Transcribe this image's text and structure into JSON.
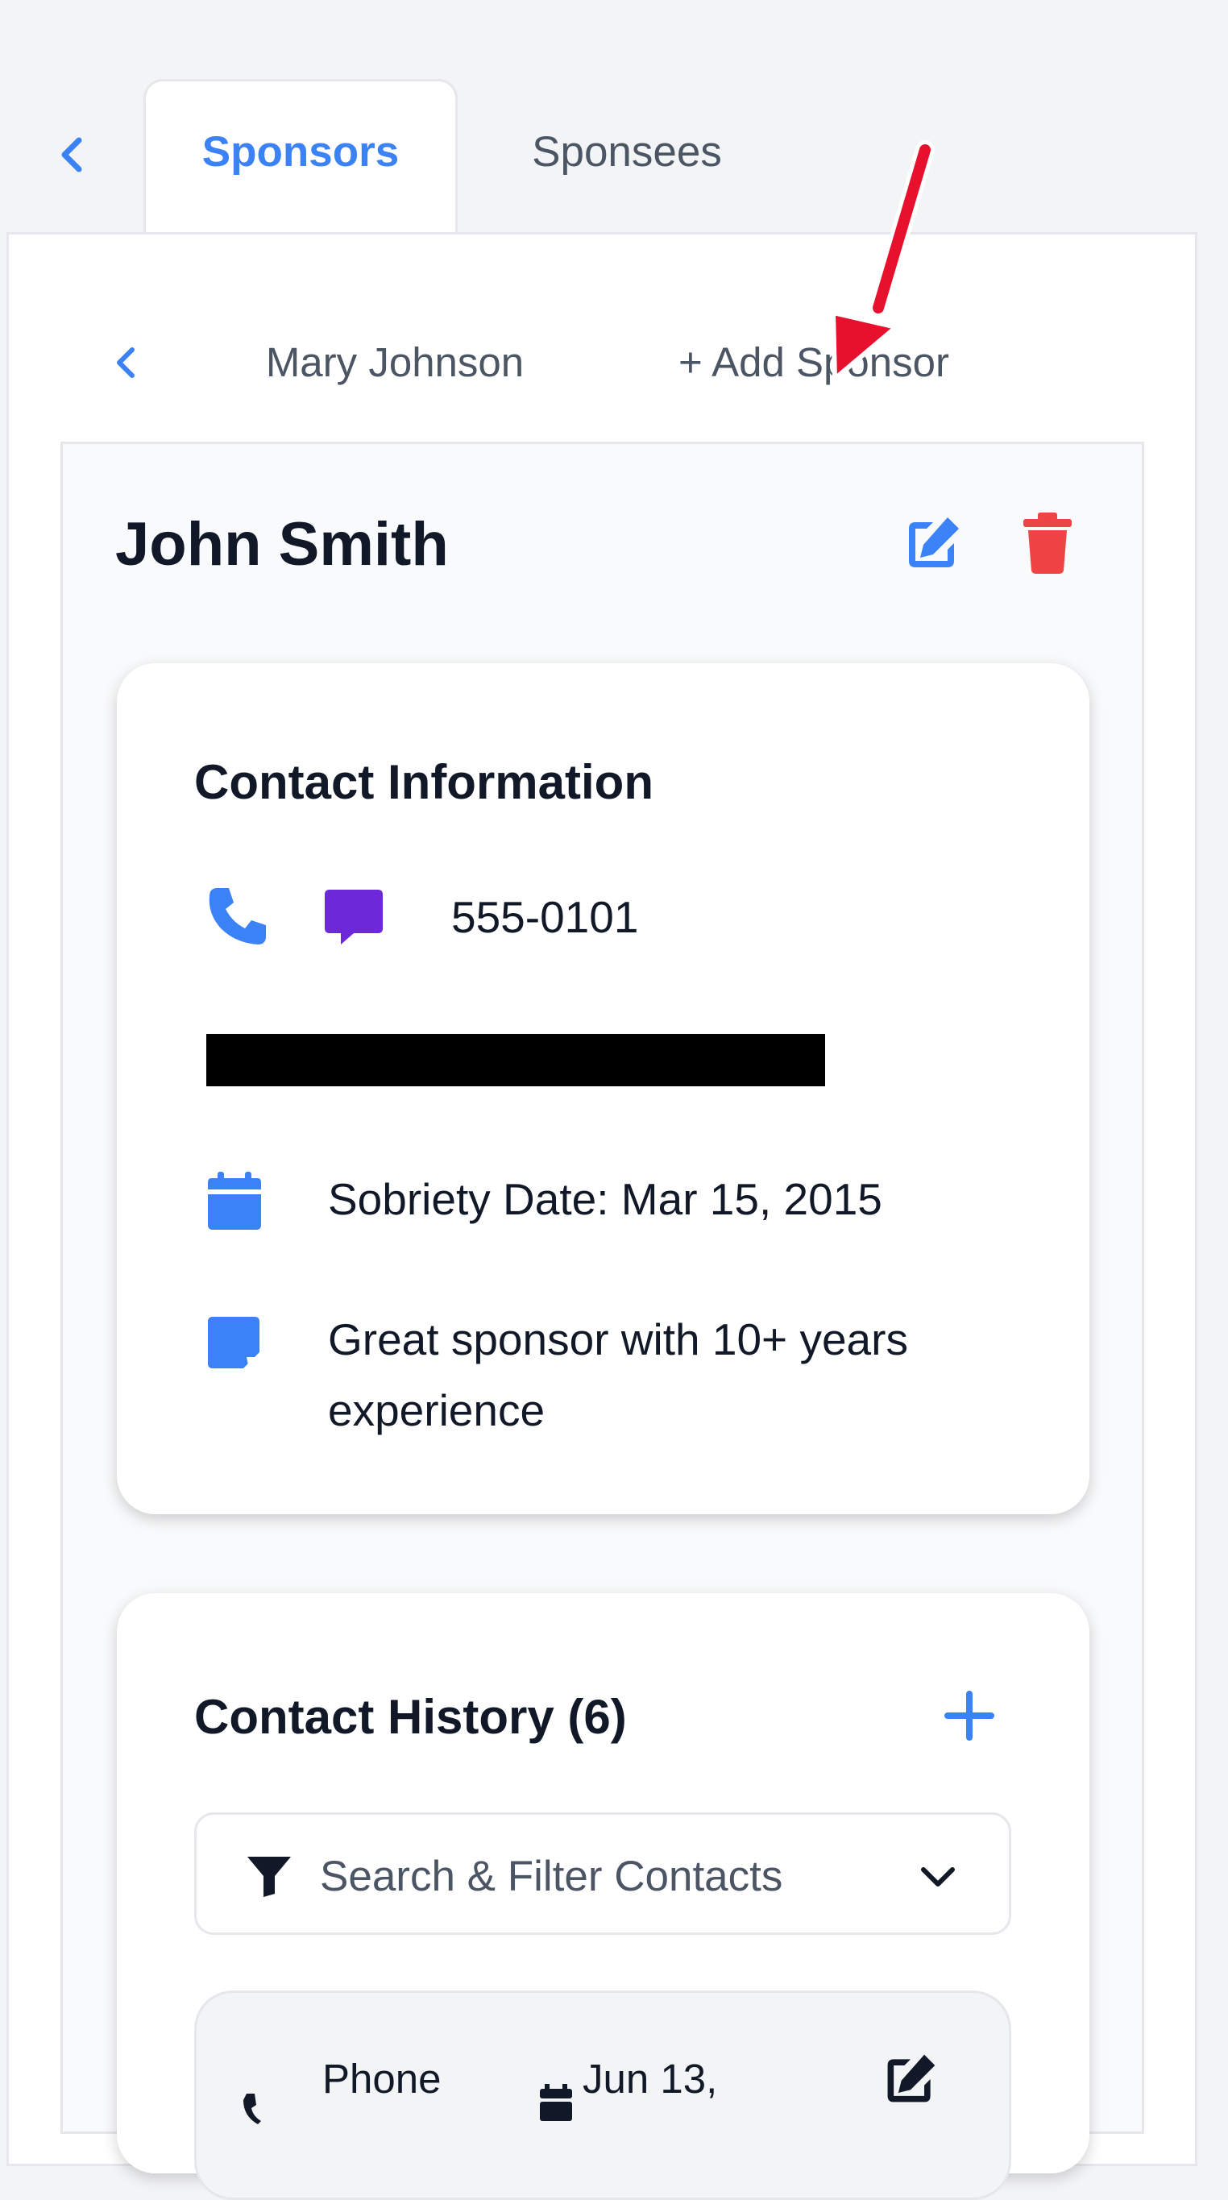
{
  "tabs": [
    {
      "label": "Sponsors",
      "active": true
    },
    {
      "label": "Sponsees",
      "active": false
    }
  ],
  "sponsor_nav": {
    "current_name": "Mary Johnson",
    "add_label": "+ Add Sponsor"
  },
  "sponsor": {
    "name": "John Smith"
  },
  "contact_info": {
    "title": "Contact Information",
    "phone": "555-0101",
    "sobriety": "Sobriety Date: Mar 15, 2015",
    "notes": "Great sponsor with 10+ years experience"
  },
  "contact_history": {
    "title": "Contact History (6)",
    "search_label": "Search & Filter Contacts",
    "items": [
      {
        "type": "Phone",
        "date": "Jun 13,"
      }
    ]
  },
  "colors": {
    "accent": "#3b82f6",
    "danger": "#ef4444",
    "message": "#6d28d9",
    "annotation_arrow": "#e8112d"
  },
  "icons": [
    "back-chevron-icon",
    "edit-icon",
    "trash-icon",
    "phone-icon",
    "message-icon",
    "calendar-icon",
    "note-icon",
    "plus-icon",
    "filter-icon",
    "chevron-down-icon"
  ]
}
